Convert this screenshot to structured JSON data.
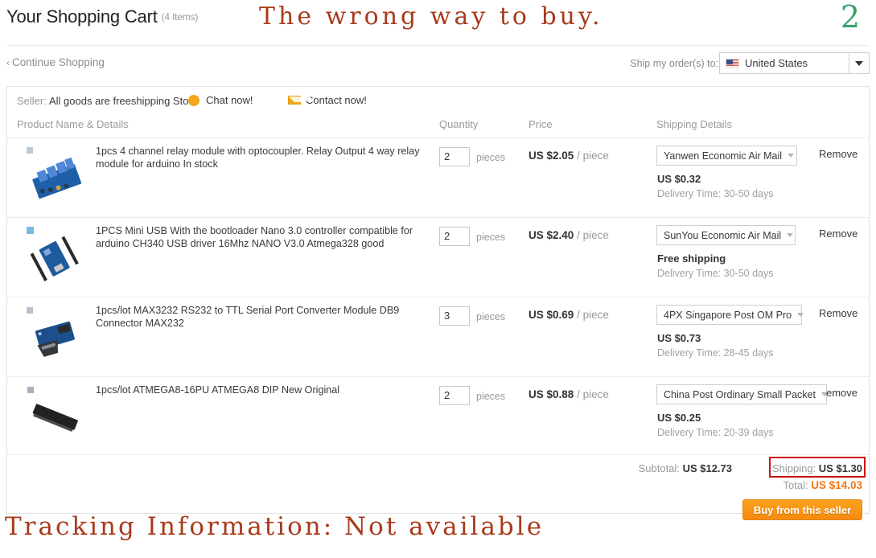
{
  "header": {
    "title": "Your Shopping Cart",
    "item_count": "(4 Items)",
    "overlay_caption": "The wrong way to buy.",
    "step_number": "2",
    "overlay_color": "#a83b1b",
    "step_color": "#36a06a"
  },
  "subbar": {
    "continue_shopping": "Continue Shopping",
    "chevron": "‹",
    "ship_to_label": "Ship my order(s) to:",
    "country": "United States"
  },
  "seller": {
    "label": "Seller:",
    "name": "All goods are freeshipping Store",
    "chat": "Chat now!",
    "contact": "Contact now!"
  },
  "columns": {
    "product": "Product Name & Details",
    "quantity": "Quantity",
    "price": "Price",
    "shipping": "Shipping Details"
  },
  "rows": [
    {
      "name": "1pcs 4 channel relay module with optocoupler. Relay Output 4 way relay module for arduino In stock",
      "qty": "2",
      "qty_unit": "pieces",
      "price": "US $2.05",
      "price_per": "/ piece",
      "ship_method": "Yanwen Economic Air Mail",
      "ship_cost": "US $0.32",
      "ship_eta": "Delivery Time: 30-50 days",
      "remove": "Remove"
    },
    {
      "name": "1PCS Mini USB With the bootloader Nano 3.0 controller compatible for arduino CH340 USB driver 16Mhz NANO V3.0 Atmega328 good",
      "qty": "2",
      "qty_unit": "pieces",
      "price": "US $2.40",
      "price_per": "/ piece",
      "ship_method": "SunYou Economic Air Mail",
      "ship_cost": "Free shipping",
      "ship_eta": "Delivery Time: 30-50 days",
      "remove": "Remove"
    },
    {
      "name": "1pcs/lot MAX3232 RS232 to TTL Serial Port Converter Module DB9 Connector MAX232",
      "qty": "3",
      "qty_unit": "pieces",
      "price": "US $0.69",
      "price_per": "/ piece",
      "ship_method": "4PX Singapore Post OM Pro",
      "ship_cost": "US $0.73",
      "ship_eta": "Delivery Time: 28-45 days",
      "remove": "Remove"
    },
    {
      "name": "1pcs/lot ATMEGA8-16PU ATMEGA8 DIP New Original",
      "qty": "2",
      "qty_unit": "pieces",
      "price": "US $0.88",
      "price_per": "/ piece",
      "ship_method": "China Post Ordinary Small Packet",
      "ship_cost": "US $0.25",
      "ship_eta": "Delivery Time: 20-39 days",
      "remove": "emove"
    }
  ],
  "totals": {
    "subtotal_label": "Subtotal:",
    "subtotal_value": "US $12.73",
    "shipping_label": "Shipping:",
    "shipping_value": "US $1.30",
    "total_label": "Total:",
    "total_value": "US $14.03",
    "total_color": "#f07818",
    "highlight_color": "#cc1111",
    "buy_button": "Buy from this seller"
  },
  "bottom_overlay": {
    "text": "Tracking Information: Not available"
  }
}
